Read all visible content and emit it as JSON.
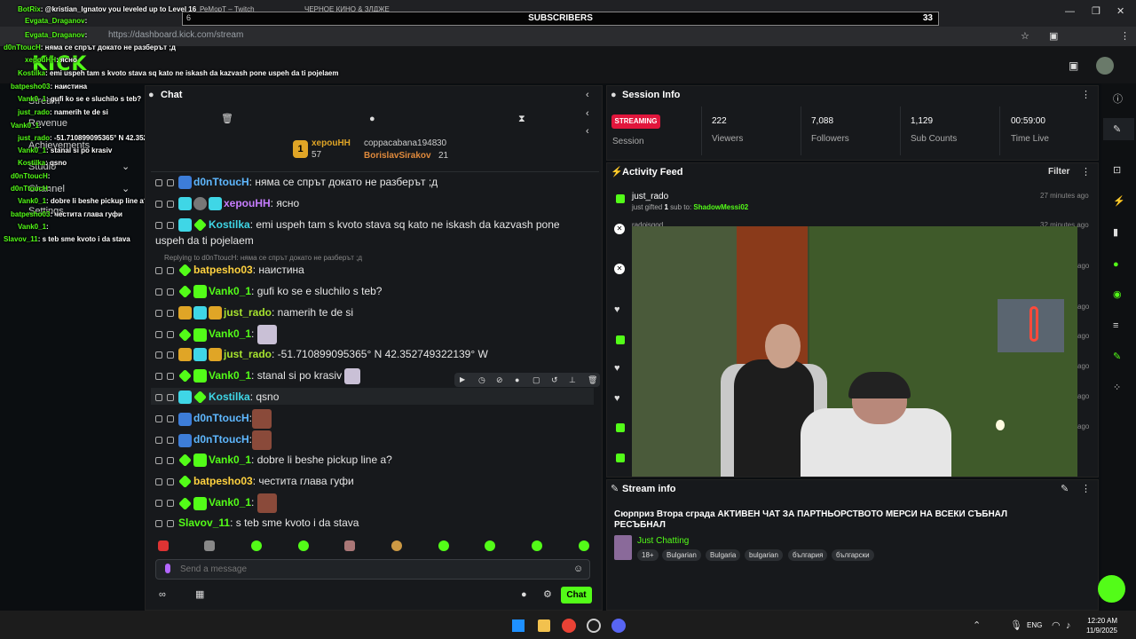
{
  "browser": {
    "tabs": [
      "РеМорТ – Twitch",
      "ЧЕРНОЕ КИНО & ЗЛДЖЕ"
    ],
    "url": "https://dashboard.kick.com/stream"
  },
  "subscribers_bar": {
    "left": "6",
    "label": "SUBSCRIBERS",
    "count": "33"
  },
  "overlay_chat": [
    {
      "user": "BotRix",
      "text": ": @kristian_lgnatov you leveled up to Level 16"
    },
    {
      "user": "Evgata_Draganov",
      "text": ":"
    },
    {
      "user": "Evgata_Draganov",
      "text": ":"
    },
    {
      "user": "d0nTtoucH",
      "text": ": няма се спрът докато не разберът ;д"
    },
    {
      "user": "xepouHH",
      "text": ": ясно"
    },
    {
      "user": "Kostilka",
      "text": ": emi uspeh tam s kvoto stava sq kato ne iskash da kazvash pone uspeh da ti pojelaem"
    },
    {
      "user": "batpesho03",
      "text": ": наистина"
    },
    {
      "user": "Vank0_1",
      "text": ": gufi ko se e sluchilo s teb?"
    },
    {
      "user": "just_rado",
      "text": ": namerih te de si"
    },
    {
      "user": "Vank0_1",
      "text": ":"
    },
    {
      "user": "just_rado",
      "text": ": -51.710899095365° N 42.352749322139° W"
    },
    {
      "user": "Vank0_1",
      "text": ": stanal si po krasiv"
    },
    {
      "user": "Kostilka",
      "text": ": qsno"
    },
    {
      "user": "d0nTtoucH",
      "text": ":"
    },
    {
      "user": "d0nTtoucH",
      "text": ":"
    },
    {
      "user": "Vank0_1",
      "text": ": dobre li beshe pickup line a?"
    },
    {
      "user": "batpesho03",
      "text": ": честита глава гуфи"
    },
    {
      "user": "Vank0_1",
      "text": ":"
    },
    {
      "user": "Slavov_11",
      "text": ": s teb sme kvoto i da stava"
    }
  ],
  "sidebar": [
    "Stream",
    "Revenue",
    "Achievements",
    "Studio",
    "Channel",
    "Settings"
  ],
  "chat": {
    "title": "Chat",
    "leaderboard": [
      {
        "name": "xepouHH",
        "count": "57"
      },
      {
        "name": "coppacabana1948",
        "count": "30"
      },
      {
        "name": "BorislavSirakov",
        "count": "21"
      }
    ],
    "messages": [
      {
        "user": "d0nTtoucH",
        "color": "#5fb8ff",
        "text": ": няма се спрът докато не разберът ;д"
      },
      {
        "user": "xepouHH",
        "color": "#c77dff",
        "text": ": ясно"
      },
      {
        "user": "Kostilka",
        "color": "#3fd6e6",
        "text": ": emi uspeh tam s kvoto stava sq kato ne iskash da kazvash pone",
        "cont": "uspeh da ti pojelaem"
      },
      {
        "user": "batpesho03",
        "color": "#ffd23f",
        "text": ": наистина",
        "reply": "Replying to d0nTtoucH: няма се спрът докато не разберът ;д"
      },
      {
        "user": "Vank0_1",
        "color": "#53fc18",
        "text": ": gufi ko se e sluchilo s teb?"
      },
      {
        "user": "just_rado",
        "color": "#a6e22e",
        "text": ": namerih te de si"
      },
      {
        "user": "Vank0_1",
        "color": "#53fc18",
        "text": ":"
      },
      {
        "user": "just_rado",
        "color": "#a6e22e",
        "text": ": -51.710899095365° N 42.352749322139° W"
      },
      {
        "user": "Vank0_1",
        "color": "#53fc18",
        "text": ": stanal si po krasiv"
      },
      {
        "user": "Kostilka",
        "color": "#3fd6e6",
        "text": ": qsno"
      },
      {
        "user": "d0nTtoucH",
        "color": "#5fb8ff",
        "text": ":"
      },
      {
        "user": "d0nTtoucH",
        "color": "#5fb8ff",
        "text": ":"
      },
      {
        "user": "Vank0_1",
        "color": "#53fc18",
        "text": ": dobre li beshe pickup line a?"
      },
      {
        "user": "batpesho03",
        "color": "#ffd23f",
        "text": ": честита глава гуфи"
      },
      {
        "user": "Vank0_1",
        "color": "#53fc18",
        "text": ":"
      },
      {
        "user": "Slavov_11",
        "color": "#53fc18",
        "text": ": s teb sme kvoto i da stava"
      }
    ],
    "input_placeholder": "Send a message",
    "send_label": "Chat"
  },
  "session": {
    "title": "Session Info",
    "status": "STREAMING",
    "status_label": "Session",
    "stats": [
      {
        "value": "222",
        "label": "Viewers"
      },
      {
        "value": "7,088",
        "label": "Followers"
      },
      {
        "value": "1,129",
        "label": "Sub Counts"
      },
      {
        "value": "00:59:00",
        "label": "Time Live"
      }
    ]
  },
  "activity": {
    "title": "Activity Feed",
    "filter_label": "Filter",
    "first": {
      "user": "just_rado",
      "pre": "just gifted",
      "count": "1",
      "mid": "sub to:",
      "target": "ShadowMessi02",
      "time": "27 minutes ago"
    },
    "second_user": "radoisgod",
    "second_time": "32 minutes ago",
    "times": [
      "ago",
      "ago",
      "ago",
      "ago",
      "ago",
      "ago"
    ]
  },
  "stream_info": {
    "title": "Stream info",
    "description": "Сюрприз Втора сграда АКТИВЕН ЧАТ ЗА ПАРТНЬОРСТВОТО МЕРСИ НА ВСЕКИ СЪБНАЛ РЕСЪБНАЛ",
    "category": "Just Chatting",
    "tags": [
      "18+",
      "Bulgarian",
      "Bulgaria",
      "bulgarian",
      "българия",
      "български"
    ]
  },
  "taskbar": {
    "lang": "ENG",
    "time": "12:20 AM",
    "date": "11/9/2025"
  }
}
